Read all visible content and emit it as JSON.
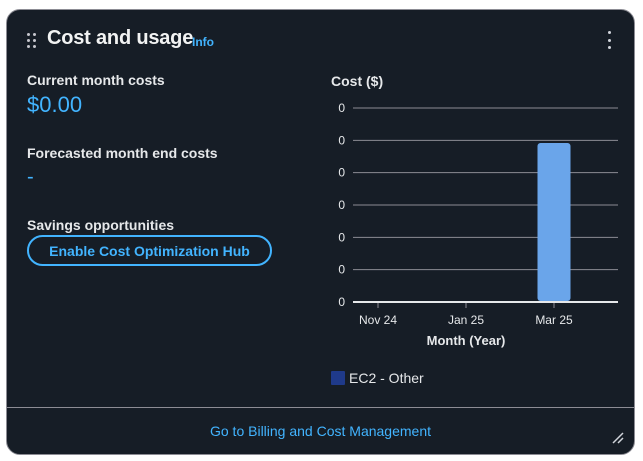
{
  "widget": {
    "title": "Cost and usage",
    "info_label": "Info",
    "menu_icon": "more-vertical-icon",
    "drag_icon": "drag-handle-icon",
    "resize_icon": "resize-handle-icon"
  },
  "summary": {
    "current_label": "Current month costs",
    "current_value": "$0.00",
    "forecast_label": "Forecasted month end costs",
    "forecast_value": "-",
    "savings_label": "Savings opportunities",
    "savings_button": "Enable Cost Optimization Hub"
  },
  "footer": {
    "link_label": "Go to Billing and Cost Management"
  },
  "colors": {
    "background": "#161d26",
    "link": "#42b4ff",
    "bar": "#6aa5ea",
    "legend_swatch": "#1f3a8a"
  },
  "chart_data": {
    "type": "bar",
    "title": "Cost ($)",
    "xlabel": "Month (Year)",
    "ylabel": "",
    "categories": [
      "Nov 24",
      "Jan 25",
      "Mar 25"
    ],
    "y_ticks": [
      "0",
      "0",
      "0",
      "0",
      "0",
      "0",
      "0"
    ],
    "series": [
      {
        "name": "EC2 - Other",
        "values": [
          0,
          0,
          0.0001
        ]
      }
    ],
    "grid": true,
    "legend_position": "bottom-left"
  }
}
